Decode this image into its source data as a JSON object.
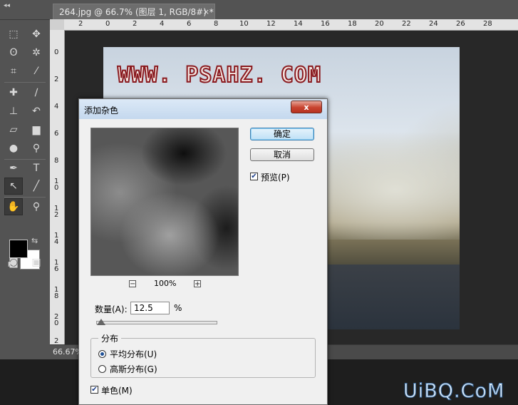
{
  "document_tab": {
    "title": "264.jpg @ 66.7% (图层 1, RGB/8#) *",
    "close": "×"
  },
  "topbar": {
    "collapse": "◂◂"
  },
  "rulers": {
    "horizontal": [
      "2",
      "0",
      "2",
      "4",
      "6",
      "8",
      "10",
      "12",
      "14",
      "16",
      "18",
      "20",
      "22",
      "24",
      "26",
      "28"
    ],
    "vertical": [
      "0",
      "2",
      "4",
      "6",
      "8",
      "1\n0",
      "1\n2",
      "1\n4",
      "1\n6",
      "1\n8",
      "2\n0",
      "2\n2"
    ]
  },
  "status": {
    "zoom": "66.67%"
  },
  "canvas": {
    "watermark": "WWW. PSAHZ. COM"
  },
  "site_logo": "UiBQ.CoM",
  "dialog": {
    "title": "添加杂色",
    "close": "x",
    "ok": "确定",
    "cancel": "取消",
    "preview_label": "预览(P)",
    "preview_checked": true,
    "zoom_out": "−",
    "zoom_in": "+",
    "zoom_level": "100%",
    "amount_label": "数量(A):",
    "amount_value": "12.5",
    "amount_unit": "%",
    "amount_fraction": 0.03,
    "distribution": {
      "legend": "分布",
      "uniform": "平均分布(U)",
      "gaussian": "高斯分布(G)",
      "selected": "uniform"
    },
    "monochrome_label": "单色(M)",
    "monochrome_checked": true
  },
  "tools": {
    "marquee": "⬚",
    "move": "✥",
    "lasso": "ʘ",
    "magic_wand": "✲",
    "crop": "⌗",
    "eyedropper": "⁄",
    "healing": "✚",
    "brush": "∕",
    "stamp": "⊥",
    "history_brush": "↶",
    "eraser": "▱",
    "gradient": "▆",
    "blur": "●",
    "dodge": "⚲",
    "pen": "✒",
    "type": "T",
    "path_select": "↖",
    "line": "╱",
    "hand": "✋",
    "zoom": "⚲",
    "swap": "⇆",
    "default": "◩",
    "quick_mask": "◙",
    "screen_mode": "▣"
  }
}
